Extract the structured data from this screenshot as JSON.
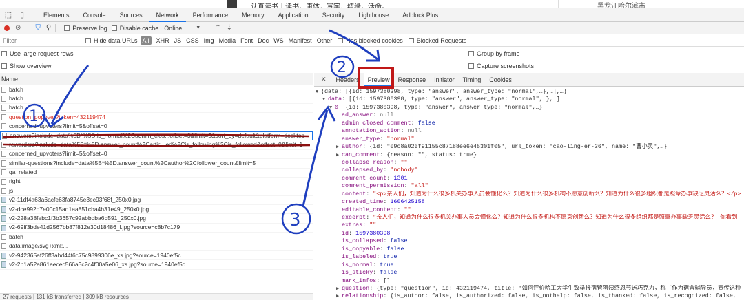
{
  "page": {
    "bio": "认真读书｜读书，康体，写字，结缘，活命。",
    "city": "黑龙江哈尔滨市"
  },
  "devtools": {
    "tabs": [
      "Elements",
      "Console",
      "Sources",
      "Network",
      "Performance",
      "Memory",
      "Application",
      "Security",
      "Lighthouse",
      "Adblock Plus"
    ],
    "active_tab": "Network"
  },
  "toolbar": {
    "preserve_log": "Preserve log",
    "disable_cache": "Disable cache",
    "throttle": "Online"
  },
  "filter": {
    "placeholder": "Filter",
    "hide_data_urls": "Hide data URLs",
    "all": "All",
    "types": [
      "XHR",
      "JS",
      "CSS",
      "Img",
      "Media",
      "Font",
      "Doc",
      "WS",
      "Manifest",
      "Other"
    ],
    "has_blocked_cookies": "Has blocked cookies",
    "blocked_requests": "Blocked Requests"
  },
  "options": {
    "large_rows": "Use large request rows",
    "show_overview": "Show overview",
    "group_by_frame": "Group by frame",
    "capture_screenshots": "Capture screenshots"
  },
  "list": {
    "header": "Name",
    "rows": [
      {
        "name": "batch",
        "kind": "doc"
      },
      {
        "name": "batch",
        "kind": "doc"
      },
      {
        "name": "batch",
        "kind": "doc"
      },
      {
        "name": "question_popover?token=432119474",
        "kind": "red"
      },
      {
        "name": "concerned_upvoters?limit=5&offset=0",
        "kind": "doc"
      },
      {
        "name": "answers?include=data%5B*%5D.is_normal%2Cadmin_clos...offset=3&limit=5&sort_by=default&platform=desktop",
        "kind": "selected"
      },
      {
        "name": "rewarders?include=data%5B*%5D.answer_count%2Cartic...ed%2Cis_following%2Cis_followed&offset=0&limit=1",
        "kind": "doc"
      },
      {
        "name": "concerned_upvoters?limit=5&offset=0",
        "kind": "doc"
      },
      {
        "name": "similar-questions?include=data%5B*%5D.answer_count%2Cauthor%2Cfollower_count&limit=5",
        "kind": "doc"
      },
      {
        "name": "qa_related",
        "kind": "doc"
      },
      {
        "name": "right",
        "kind": "doc"
      },
      {
        "name": "js",
        "kind": "doc"
      },
      {
        "name": "v2-11df4a63a6acfe63fa8745e3ec93f68f_250x0.jpg",
        "kind": "img"
      },
      {
        "name": "v2-dce992d7e00c15ad1aa851cba4b31e49_250x0.jpg",
        "kind": "img"
      },
      {
        "name": "v2-228a38febc1f3b3657c92abbdba6b591_250x0.jpg",
        "kind": "img"
      },
      {
        "name": "v2-69ff3bde41d2567bb87f812e30d18486_l.jpg?source=c8b7c179",
        "kind": "img"
      },
      {
        "name": "batch",
        "kind": "doc"
      },
      {
        "name": "data:image/svg+xml;...",
        "kind": "doc"
      },
      {
        "name": "v2-942365af26ff3abd44f6c75c9899306e_xs.jpg?source=1940ef5c",
        "kind": "img"
      },
      {
        "name": "v2-2b1a52a861aecec566a3c2c4f00a5e06_xs.jpg?source=1940ef5c",
        "kind": "img"
      }
    ],
    "status": "27 requests | 131 kB transferred | 309 kB resources"
  },
  "panel": {
    "tabs": [
      "Headers",
      "Preview",
      "Response",
      "Initiator",
      "Timing",
      "Cookies"
    ],
    "active_tab": "Preview"
  },
  "json_lines": [
    {
      "indent": 0,
      "tri": "▼",
      "key": "",
      "parts": [
        [
          "p",
          "{data: [{id: 1597380398, type: \"answer\", answer_type: \"normal\",…},…],…}"
        ]
      ]
    },
    {
      "indent": 1,
      "tri": "▼",
      "key": "data",
      "parts": [
        [
          "p",
          "[{id: 1597380398, type: \"answer\", answer_type: \"normal\",…},…]"
        ]
      ]
    },
    {
      "indent": 2,
      "tri": "▼",
      "key": "0",
      "parts": [
        [
          "p",
          "{id: 1597380398, type: \"answer\", answer_type: \"normal\",…}"
        ]
      ]
    },
    {
      "indent": 3,
      "tri": "",
      "key": "ad_answer",
      "parts": [
        [
          "nu",
          "null"
        ]
      ]
    },
    {
      "indent": 3,
      "tri": "",
      "key": "admin_closed_comment",
      "parts": [
        [
          "b",
          "false"
        ]
      ]
    },
    {
      "indent": 3,
      "tri": "",
      "key": "annotation_action",
      "parts": [
        [
          "nu",
          "null"
        ]
      ]
    },
    {
      "indent": 3,
      "tri": "",
      "key": "answer_type",
      "parts": [
        [
          "s",
          "\"normal\""
        ]
      ]
    },
    {
      "indent": 3,
      "tri": "▶",
      "key": "author",
      "parts": [
        [
          "p",
          "{id: \"09c8a026f91155c87188ee6e45301f05\", url_token: \"cao-ling-er-36\", name: \"曹小灵\",…}"
        ]
      ]
    },
    {
      "indent": 3,
      "tri": "▶",
      "key": "can_comment",
      "parts": [
        [
          "p",
          "{reason: \"\", status: true}"
        ]
      ]
    },
    {
      "indent": 3,
      "tri": "",
      "key": "collapse_reason",
      "parts": [
        [
          "s",
          "\"\""
        ]
      ]
    },
    {
      "indent": 3,
      "tri": "",
      "key": "collapsed_by",
      "parts": [
        [
          "s",
          "\"nobody\""
        ]
      ]
    },
    {
      "indent": 3,
      "tri": "",
      "key": "comment_count",
      "parts": [
        [
          "n",
          "1301"
        ]
      ]
    },
    {
      "indent": 3,
      "tri": "",
      "key": "comment_permission",
      "parts": [
        [
          "s",
          "\"all\""
        ]
      ]
    },
    {
      "indent": 3,
      "tri": "",
      "key": "content",
      "parts": [
        [
          "s",
          "\"<p>亲人们，知道为什么很多机关办事人员会懂化么？知道为什么很多机构不愿意创新么？知道为什么很多组织都是照章办事缺乏灵活么？</p>"
        ]
      ]
    },
    {
      "indent": 3,
      "tri": "",
      "key": "created_time",
      "parts": [
        [
          "n",
          "1606425158"
        ]
      ]
    },
    {
      "indent": 3,
      "tri": "",
      "key": "editable_content",
      "parts": [
        [
          "s",
          "\"\""
        ]
      ]
    },
    {
      "indent": 3,
      "tri": "",
      "key": "excerpt",
      "parts": [
        [
          "s",
          "\"亲人们，知道为什么很多机关办事人员会懂化么？知道为什么很多机构不愿意创新么？知道为什么很多组织都是照章办事缺乏灵活么？  你看到"
        ]
      ]
    },
    {
      "indent": 3,
      "tri": "",
      "key": "extras",
      "parts": [
        [
          "s",
          "\"\""
        ]
      ]
    },
    {
      "indent": 3,
      "tri": "",
      "key": "id",
      "parts": [
        [
          "n",
          "1597380398"
        ]
      ]
    },
    {
      "indent": 3,
      "tri": "",
      "key": "is_collapsed",
      "parts": [
        [
          "b",
          "false"
        ]
      ]
    },
    {
      "indent": 3,
      "tri": "",
      "key": "is_copyable",
      "parts": [
        [
          "b",
          "false"
        ]
      ]
    },
    {
      "indent": 3,
      "tri": "",
      "key": "is_labeled",
      "parts": [
        [
          "b",
          "true"
        ]
      ]
    },
    {
      "indent": 3,
      "tri": "",
      "key": "is_normal",
      "parts": [
        [
          "b",
          "true"
        ]
      ]
    },
    {
      "indent": 3,
      "tri": "",
      "key": "is_sticky",
      "parts": [
        [
          "b",
          "false"
        ]
      ]
    },
    {
      "indent": 3,
      "tri": "",
      "key": "mark_infos",
      "parts": [
        [
          "p",
          "[]"
        ]
      ]
    },
    {
      "indent": 3,
      "tri": "▶",
      "key": "question",
      "parts": [
        [
          "p",
          "{type: \"question\", id: 432119474, title: \"如何评价哈工大学生致举报宿管阿姨感恩节送巧克力，称「作为宿舍辅导员，宣传这种"
        ]
      ]
    },
    {
      "indent": 3,
      "tri": "▶",
      "key": "relationship",
      "parts": [
        [
          "p",
          "{is_author: false, is_authorized: false, is_nothelp: false, is_thanked: false, is_recognized: false,"
        ]
      ]
    }
  ],
  "annotations": {
    "labels": [
      "①",
      "②",
      "③"
    ],
    "arrow_color": "#1f3fbf",
    "box_color": "#c01818",
    "underline_color": "#8b1010"
  }
}
